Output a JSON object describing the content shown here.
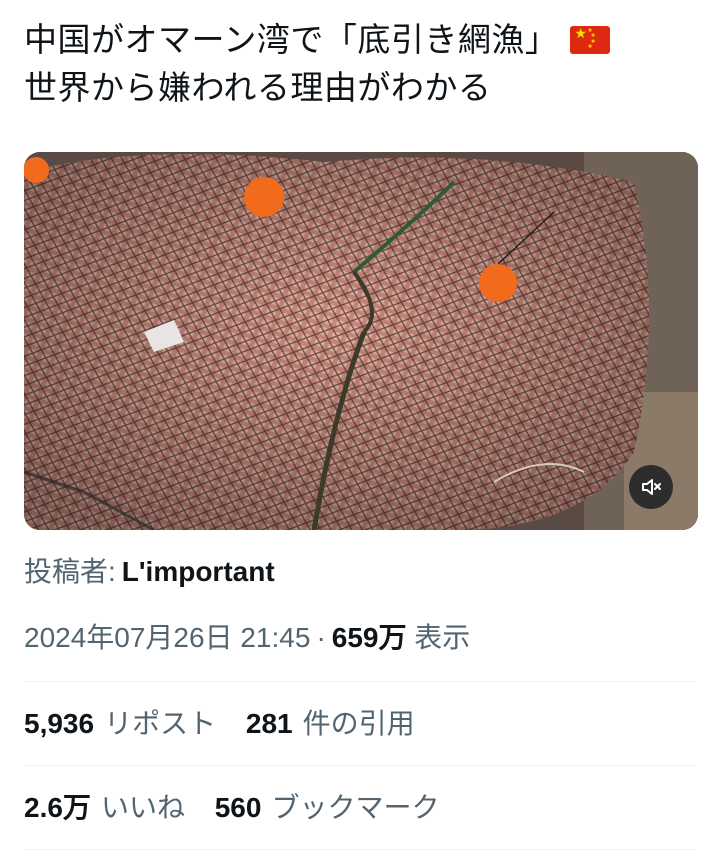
{
  "post": {
    "title_line1": "中国がオマーン湾で「底引き網漁」",
    "title_line2": "世界から嫌われる理由がわかる",
    "flag_icon": "china-flag-emoji"
  },
  "media": {
    "type": "video",
    "mute_icon": "speaker-muted-icon",
    "colors": {
      "net_base": "#b57f73",
      "catch_pink": "#d9a596",
      "float_orange": "#f26b1d",
      "net_line": "#4a2f2a"
    }
  },
  "author": {
    "label": "投稿者:",
    "name": "L'important"
  },
  "meta": {
    "date": "2024年07月26日 21:45",
    "separator": "·",
    "views_count": "659万",
    "views_label": "表示"
  },
  "stats": {
    "reposts_count": "5,936",
    "reposts_label": "リポスト",
    "quotes_count": "281",
    "quotes_label": "件の引用",
    "likes_count": "2.6万",
    "likes_label": "いいね",
    "bookmarks_count": "560",
    "bookmarks_label": "ブックマーク"
  }
}
